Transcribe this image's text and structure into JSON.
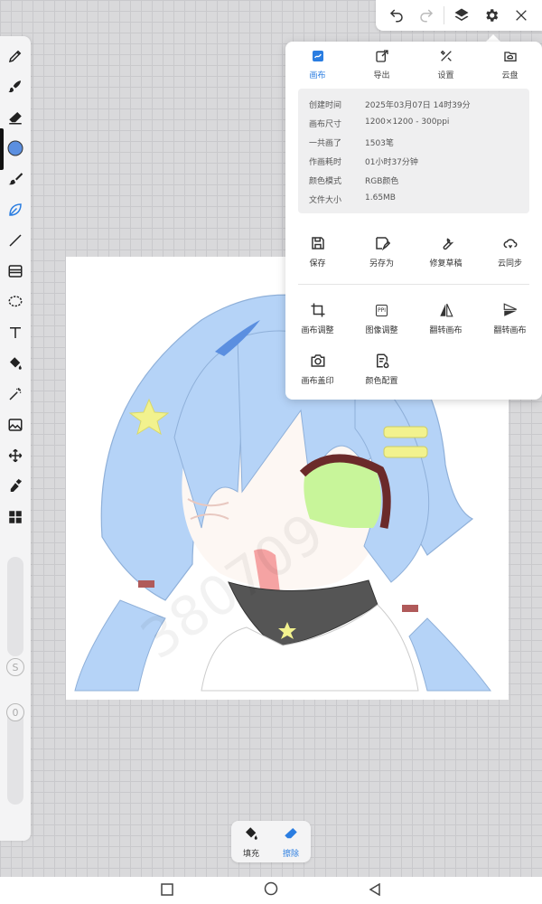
{
  "colors": {
    "accent": "#2a7de1",
    "active_color_swatch": "#5b8fe0",
    "hair": "#b5d3f7",
    "eye": "#c8f59a",
    "star": "#f2f28e",
    "collar": "#555555"
  },
  "top_toolbar": {
    "icons": [
      "undo-icon",
      "redo-icon",
      "layers-icon",
      "gear-icon",
      "close-icon"
    ]
  },
  "left_toolbar": {
    "tools": [
      "pen-tool-icon",
      "brush-tool-icon",
      "eraser-tool-icon",
      "color-swatch",
      "smudge-tool-icon",
      "leaf-brush-tool-icon",
      "line-tool-icon",
      "gradient-tool-icon",
      "lasso-tool-icon",
      "text-tool-icon",
      "fill-bucket-icon",
      "magic-wand-icon",
      "image-import-icon",
      "transform-icon",
      "eyedropper-icon",
      "grid-tool-icon"
    ],
    "size_knob_label": "S",
    "opacity_knob_label": "0"
  },
  "canvas": {
    "watermark": "380709"
  },
  "settings_panel": {
    "tabs": [
      {
        "label": "画布",
        "icon": "canvas-tab-icon",
        "active": true
      },
      {
        "label": "导出",
        "icon": "export-icon",
        "active": false
      },
      {
        "label": "设置",
        "icon": "tools-icon",
        "active": false
      },
      {
        "label": "云盘",
        "icon": "cloud-folder-icon",
        "active": false
      }
    ],
    "info": [
      {
        "key": "创建时间",
        "value": "2025年03月07日 14时39分"
      },
      {
        "key": "画布尺寸",
        "value": "1200×1200 - 300ppi"
      },
      {
        "key": "一共画了",
        "value": "1503笔"
      },
      {
        "key": "作画耗时",
        "value": "01小时37分钟"
      },
      {
        "key": "颜色模式",
        "value": "RGB颜色"
      },
      {
        "key": "文件大小",
        "value": "1.65MB"
      }
    ],
    "actions_row1": [
      {
        "label": "保存",
        "icon": "save-icon"
      },
      {
        "label": "另存为",
        "icon": "save-as-icon"
      },
      {
        "label": "修复草稿",
        "icon": "wrench-icon"
      },
      {
        "label": "云同步",
        "icon": "cloud-sync-icon"
      }
    ],
    "actions_row2": [
      {
        "label": "画布调整",
        "icon": "crop-icon"
      },
      {
        "label": "图像调整",
        "icon": "ppi-icon"
      },
      {
        "label": "翻转画布",
        "icon": "flip-horizontal-icon"
      },
      {
        "label": "翻转画布",
        "icon": "flip-vertical-icon"
      }
    ],
    "actions_row3": [
      {
        "label": "画布盖印",
        "icon": "camera-icon"
      },
      {
        "label": "颜色配置",
        "icon": "color-config-icon"
      }
    ],
    "ppi_icon_text": "PPI"
  },
  "bottom_bar": {
    "fill_label": "填充",
    "erase_label": "擦除"
  },
  "nav_bar": {
    "icons": [
      "recents-square-icon",
      "home-circle-icon",
      "back-triangle-icon"
    ]
  }
}
